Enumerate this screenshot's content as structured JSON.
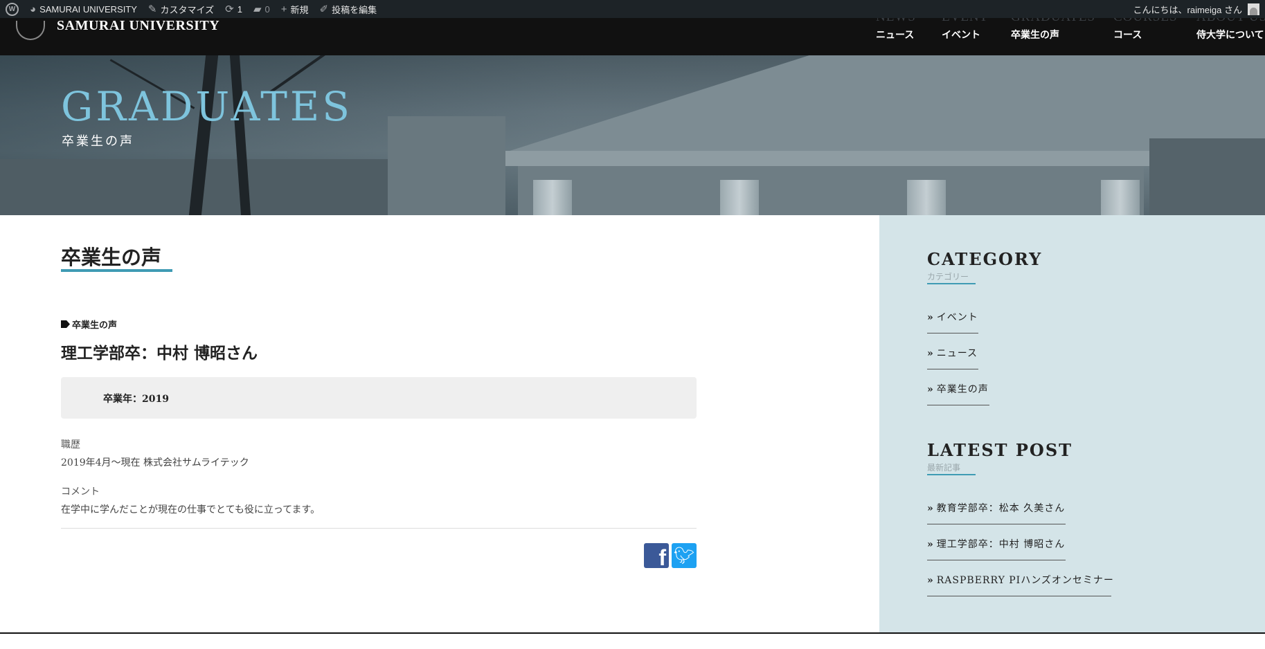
{
  "adminbar": {
    "site_name": "SAMURAI UNIVERSITY",
    "customize": "カスタマイズ",
    "updates_count": "1",
    "comments_count": "0",
    "new_label": "新規",
    "edit_post": "投稿を編集",
    "greeting": "こんにちは、raimeiga さん"
  },
  "header": {
    "logo_text": "SAMURAI UNIVERSITY",
    "nav": [
      {
        "en": "NEWS",
        "jp": "ニュース"
      },
      {
        "en": "EVENT",
        "jp": "イベント"
      },
      {
        "en": "GRADUATES",
        "jp": "卒業生の声"
      },
      {
        "en": "COURSES",
        "jp": "コース"
      },
      {
        "en": "ABOUT US",
        "jp": "侍大学について"
      }
    ]
  },
  "hero": {
    "title": "GRADUATES",
    "subtitle": "卒業生の声"
  },
  "main": {
    "page_title": "卒業生の声",
    "tag": "卒業生の声",
    "post_title": "理工学部卒：中村 博昭さん",
    "grad_year": "卒業年：2019",
    "career_label": "職歴",
    "career_value": "2019年4月〜現在 株式会社サムライテック",
    "comment_label": "コメント",
    "comment_value": "在学中に学んだことが現在の仕事でとても役に立ってます。"
  },
  "sidebar": {
    "category": {
      "title": "CATEGORY",
      "subtitle": "カテゴリー",
      "items": [
        "イベント",
        "ニュース",
        "卒業生の声"
      ]
    },
    "latest": {
      "title": "LATEST POST",
      "subtitle": "最新記事",
      "items": [
        "教育学部卒：松本 久美さん",
        "理工学部卒：中村 博昭さん",
        "RASPBERRY PIハンズオンセミナー"
      ]
    }
  },
  "colors": {
    "accent": "#3f9bb4",
    "hero_title": "#7ec4dd",
    "sidebar_bg": "#d4e4e8",
    "adminbar_bg": "#1d2327",
    "facebook": "#3b5998",
    "twitter": "#1da1f2"
  },
  "icons": [
    "wordpress-icon",
    "dashboard-icon",
    "brush-icon",
    "update-icon",
    "comment-icon",
    "plus-icon",
    "pencil-icon",
    "user-icon",
    "tag-icon",
    "facebook-icon",
    "twitter-icon"
  ]
}
